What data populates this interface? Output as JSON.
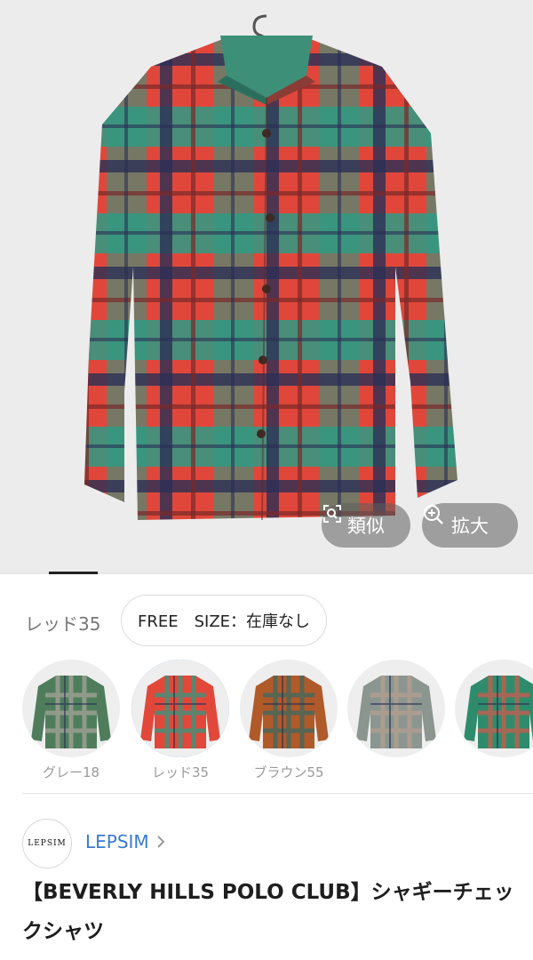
{
  "gallery": {
    "similar_button": {
      "label": "類似",
      "icon": "image-search-icon"
    },
    "zoom_button": {
      "label": "拡大",
      "icon": "zoom-in-icon"
    },
    "active_index": 1
  },
  "variant": {
    "color_label": "レッド35",
    "size_stock_text": "FREE　SIZE：在庫なし"
  },
  "swatches": [
    {
      "label": "グレー18",
      "selected": false,
      "colors": [
        "#4f7d5c",
        "#a6a49a"
      ]
    },
    {
      "label": "レッド35",
      "selected": true,
      "colors": [
        "#e2483a",
        "#2f9a82"
      ]
    },
    {
      "label": "ブラウン55",
      "selected": false,
      "colors": [
        "#b05a2a",
        "#3b6a62"
      ]
    },
    {
      "label": "",
      "selected": false,
      "colors": [
        "#8c9690",
        "#b59f8f"
      ]
    },
    {
      "label": "",
      "selected": false,
      "colors": [
        "#2e8c6c",
        "#cf5b4c"
      ]
    }
  ],
  "brand": {
    "logo_text": "LEPSIM",
    "name": "LEPSIM",
    "chevron_icon": "chevron-right-icon"
  },
  "product": {
    "title": "【BEVERLY HILLS POLO CLUB】シャギーチェックシャツ"
  },
  "colors": {
    "accent": "#3a7bd5",
    "selected_ring": "#4a90d9",
    "shirt_red": "#e2483a",
    "shirt_green": "#2f9a82",
    "shirt_navy": "#2a2f55"
  }
}
